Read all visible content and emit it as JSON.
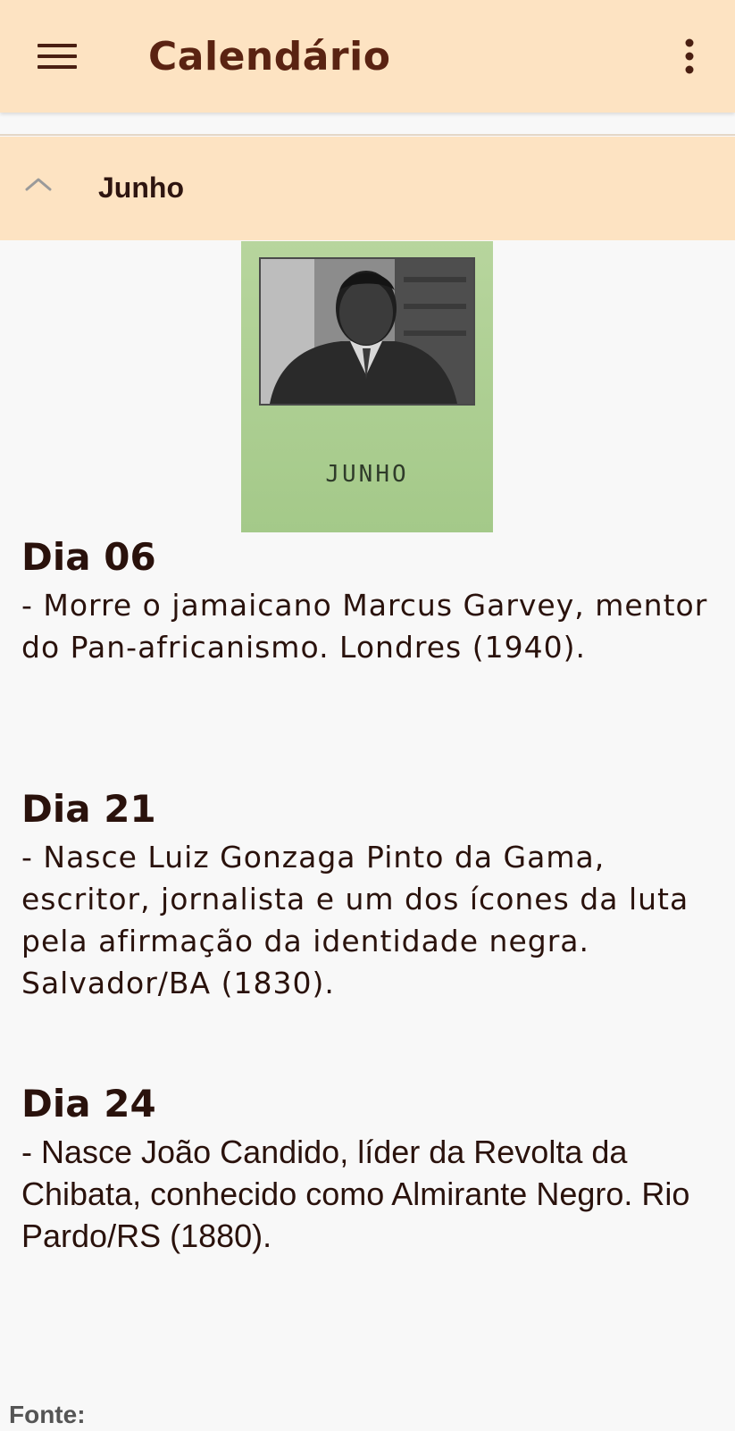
{
  "app_bar": {
    "title": "Calendário",
    "menu_icon": "hamburger-menu-icon",
    "more_icon": "more-vert-icon"
  },
  "section": {
    "title": "Junho",
    "expanded": true,
    "chevron_icon": "chevron-up-icon"
  },
  "month_card": {
    "label": "JUNHO"
  },
  "entries": [
    {
      "heading": "Dia 06",
      "text": "- Morre o jamaicano Marcus Garvey, mentor do Pan-africanismo. Londres (1940)."
    },
    {
      "heading": "Dia 21",
      "text": "- Nasce Luiz Gonzaga Pinto da Gama, escritor, jornalista e um dos ícones da luta pela afirmação da identidade negra. Salvador/BA (1830)."
    },
    {
      "heading": "Dia 24",
      "text": "- Nasce João Candido, líder da Revolta da Chibata, conhecido como Almirante Negro. Rio Pardo/RS (1880)."
    }
  ],
  "footer": {
    "source_label": "Fonte:"
  },
  "colors": {
    "app_bar_bg": "#fde3c2",
    "title_color": "#5a2312",
    "card_green": "#b7d59d",
    "text_color": "#2a120c"
  }
}
